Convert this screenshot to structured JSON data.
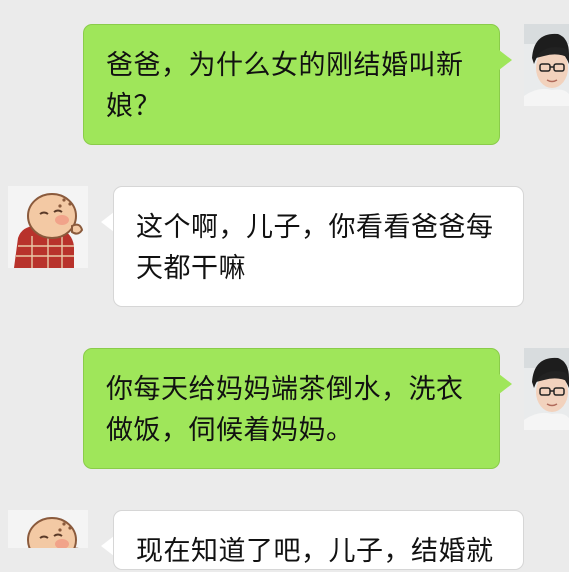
{
  "messages": [
    {
      "sender": "son",
      "side": "right",
      "avatar_icon": "boy-photo-avatar-icon",
      "text": "爸爸，为什么女的刚结婚叫新娘？"
    },
    {
      "sender": "dad",
      "side": "left",
      "avatar_icon": "cartoon-monk-avatar-icon",
      "text": "这个啊，儿子，你看看爸爸每天都干嘛"
    },
    {
      "sender": "son",
      "side": "right",
      "avatar_icon": "boy-photo-avatar-icon",
      "text": "你每天给妈妈端茶倒水，洗衣做饭，伺候着妈妈。"
    },
    {
      "sender": "dad",
      "side": "left",
      "avatar_icon": "cartoon-monk-avatar-icon",
      "text": "现在知道了吧，儿子，结婚就"
    }
  ],
  "colors": {
    "background": "#ebebeb",
    "outgoing_bubble": "#9fe65a",
    "incoming_bubble": "#ffffff"
  }
}
